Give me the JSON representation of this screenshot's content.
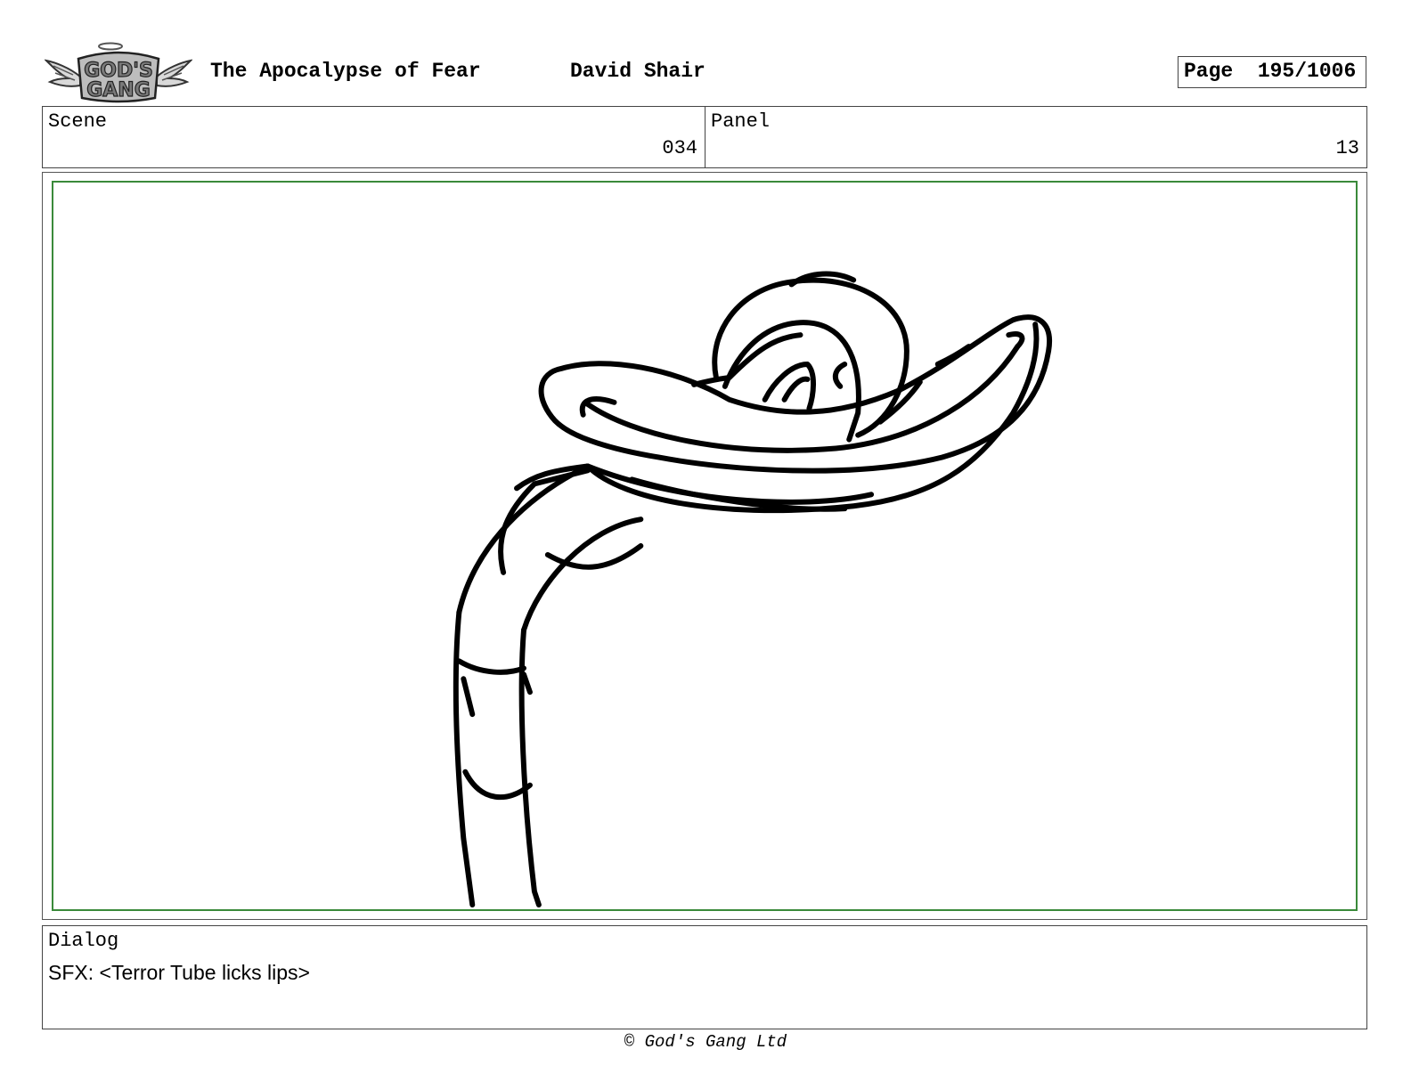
{
  "header": {
    "logo_text": "GOD'S GANG",
    "title": "The Apocalypse of Fear",
    "author": "David Shair",
    "page_label": "Page",
    "page_number": "195/1006"
  },
  "info": {
    "scene_label": "Scene",
    "scene_value": "034",
    "panel_label": "Panel",
    "panel_value": "13"
  },
  "dialog": {
    "label": "Dialog",
    "text": "SFX: <Terror Tube licks lips>"
  },
  "footer": {
    "copyright": "© God's Gang Ltd"
  },
  "colors": {
    "safe_frame": "#3a8a3a",
    "border": "#444444",
    "ink": "#000000"
  }
}
